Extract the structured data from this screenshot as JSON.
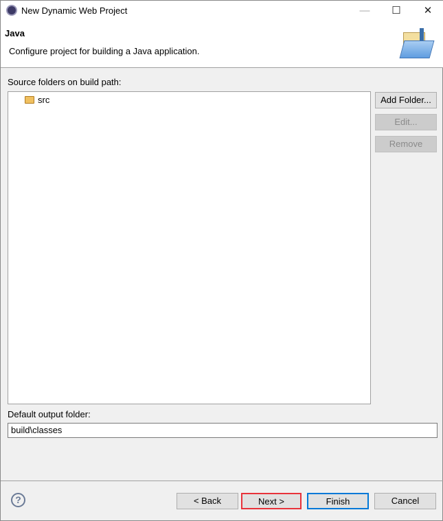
{
  "window": {
    "title": "New Dynamic Web Project",
    "minimize_icon": "minimize-icon",
    "maximize_icon": "maximize-icon",
    "close_icon": "close-icon",
    "minimize": "—",
    "maximize": "☐",
    "close": "✕"
  },
  "header": {
    "title": "Java",
    "description": "Configure project for building a Java application."
  },
  "source": {
    "label": "Source folders on build path:",
    "items": [
      {
        "label": "src",
        "icon": "source-folder-icon"
      }
    ]
  },
  "side_buttons": {
    "add": "Add Folder...",
    "edit": "Edit...",
    "remove": "Remove"
  },
  "output": {
    "label": "Default output folder:",
    "value": "build\\classes"
  },
  "footer": {
    "help": "?",
    "back": "< Back",
    "next": "Next >",
    "finish": "Finish",
    "cancel": "Cancel"
  },
  "colors": {
    "next_highlight": "#e8323a",
    "finish_focus": "#0078d7"
  }
}
